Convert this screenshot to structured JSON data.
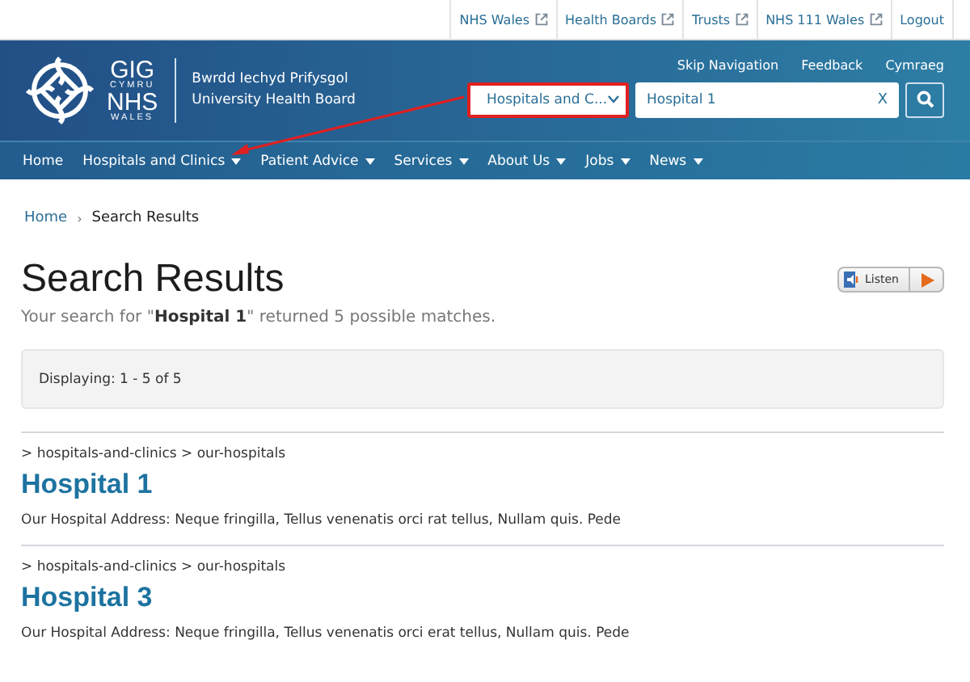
{
  "top_links": [
    {
      "label": "NHS Wales",
      "external": true
    },
    {
      "label": "Health Boards",
      "external": true
    },
    {
      "label": "Trusts",
      "external": true
    },
    {
      "label": "NHS 111 Wales",
      "external": true
    },
    {
      "label": "Logout",
      "external": false
    }
  ],
  "logo": {
    "line_1": "GIG",
    "line_2": "CYMRU",
    "line_3": "NHS",
    "line_4": "WALES",
    "board_line_1": "Bwrdd Iechyd Prifysgol",
    "board_line_2": "University Health Board"
  },
  "header_links": [
    "Skip Navigation",
    "Feedback",
    "Cymraeg"
  ],
  "search": {
    "scope": {
      "value": "Hospitals and C...",
      "highlighted": true
    },
    "query": "Hospital 1",
    "clear": "X"
  },
  "nav": [
    {
      "label": "Home",
      "dropdown": false,
      "arrow_target": false
    },
    {
      "label": "Hospitals and Clinics",
      "dropdown": true,
      "arrow_target": true
    },
    {
      "label": "Patient Advice",
      "dropdown": true,
      "arrow_target": false
    },
    {
      "label": "Services",
      "dropdown": true,
      "arrow_target": false
    },
    {
      "label": "About Us",
      "dropdown": true,
      "arrow_target": false
    },
    {
      "label": "Jobs",
      "dropdown": true,
      "arrow_target": false
    },
    {
      "label": "News",
      "dropdown": true,
      "arrow_target": false
    }
  ],
  "breadcrumb_separator": "›",
  "breadcrumb": [
    {
      "label": "Home",
      "link": true
    },
    {
      "label": "Search Results",
      "link": false
    }
  ],
  "page_title": "Search Results",
  "listen": {
    "label": "Listen"
  },
  "summary": "Your search for \"**Hospital 1**\" returned 5 possible matches.",
  "displaying": "Displaying: 1 - 5 of 5",
  "results": [
    {
      "path": "> hospitals-and-clinics > our-hospitals",
      "title": "Hospital 1",
      "address": "Our Hospital Address: Neque fringilla, Tellus venenatis orci rat tellus, Nullam quis. Pede"
    },
    {
      "path": "> hospitals-and-clinics > our-hospitals",
      "title": "Hospital 3",
      "address": "Our Hospital Address: Neque fringilla, Tellus venenatis orci erat tellus, Nullam quis. Pede"
    }
  ]
}
